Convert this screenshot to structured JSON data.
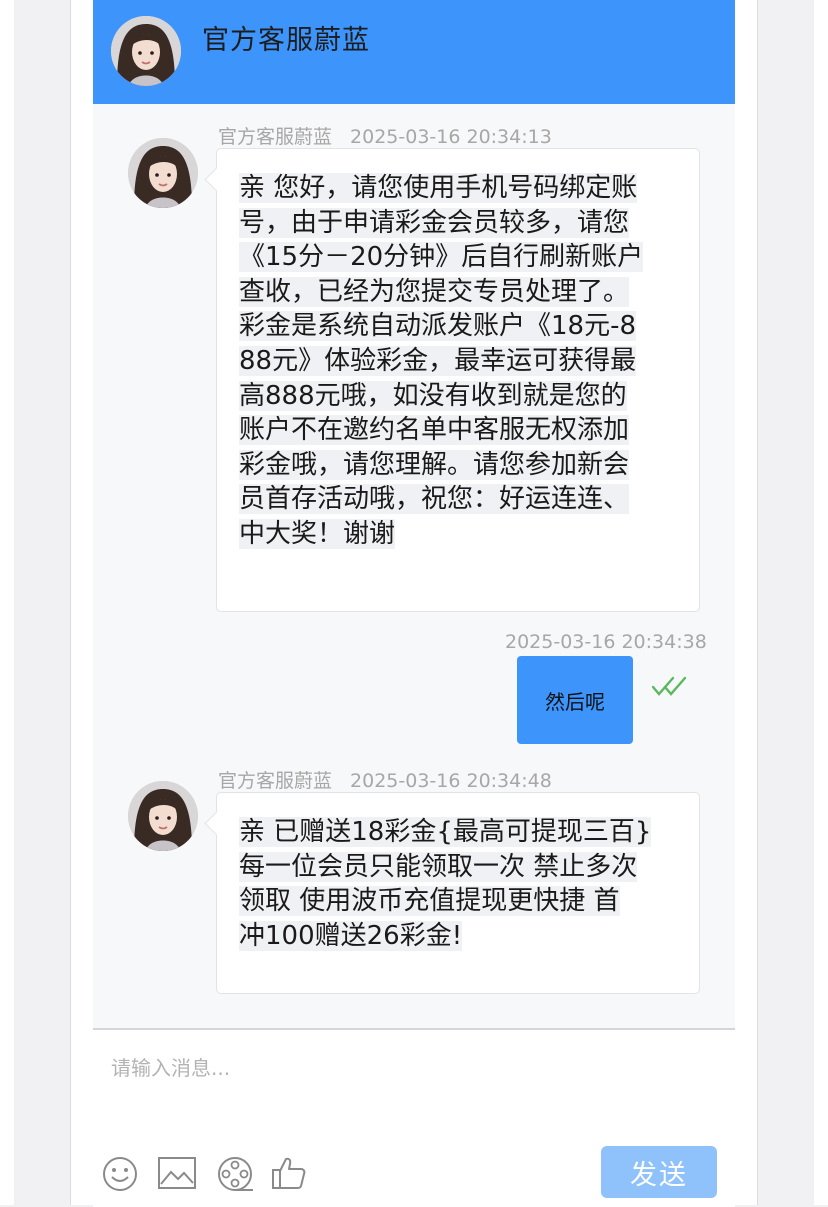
{
  "header": {
    "title": "官方客服蔚蓝"
  },
  "messages": [
    {
      "sender": "官方客服蔚蓝",
      "time": "2025-03-16 20:34:13",
      "lines": [
        "亲 您好，请您使用手机号码绑定账",
        "号，由于申请彩金会员较多，请您",
        "《15分－20分钟》后自行刷新账户",
        "查收，已经为您提交专员处理了。",
        "彩金是系统自动派发账户《18元-8",
        "88元》体验彩金，最幸运可获得最",
        "高888元哦，如没有收到就是您的",
        "账户不在邀约名单中客服无权添加",
        "彩金哦，请您理解。请您参加新会",
        "员首存活动哦，祝您：好运连连、",
        "中大奖！谢谢"
      ]
    },
    {
      "time": "2025-03-16 20:34:38",
      "text": "然后呢",
      "status": "read",
      "status_icon": "double-check-icon",
      "status_color": "#5cb85c"
    },
    {
      "sender": "官方客服蔚蓝",
      "time": "2025-03-16 20:34:48",
      "lines": [
        "亲 已赠送18彩金{最高可提现三百}",
        "每一位会员只能领取一次 禁止多次",
        "领取 使用波币充值提现更快捷 首",
        "冲100赠送26彩金!"
      ]
    }
  ],
  "input": {
    "placeholder": "请输入消息...",
    "value": ""
  },
  "toolbar": {
    "icons": [
      "emoji-icon",
      "image-icon",
      "film-reel-icon",
      "thumbs-up-icon"
    ],
    "send_label": "发送"
  },
  "colors": {
    "accent": "#3d95fb",
    "send_disabled": "#8fc1fb",
    "read_check": "#5cb85c"
  }
}
